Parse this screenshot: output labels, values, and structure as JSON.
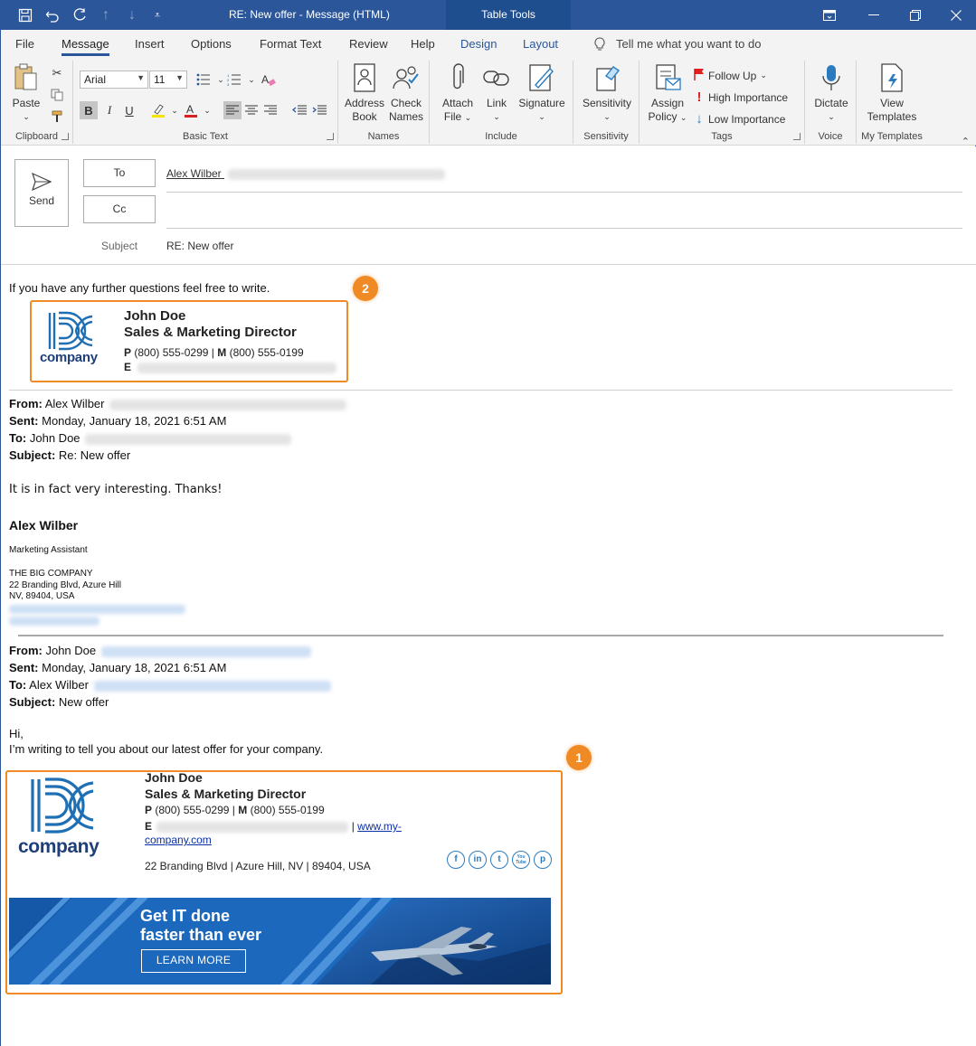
{
  "window": {
    "title": "RE: New offer  -  Message (HTML)",
    "context_tab": "Table Tools",
    "accent": "#2b579a"
  },
  "tabs": [
    "File",
    "Message",
    "Insert",
    "Options",
    "Format Text",
    "Review",
    "Help",
    "Design",
    "Layout"
  ],
  "tell_me": "Tell me what you want to do",
  "ribbon": {
    "clipboard": {
      "paste": "Paste",
      "label": "Clipboard"
    },
    "basic_text": {
      "font": "Arial",
      "size": "11",
      "label": "Basic Text"
    },
    "names": {
      "address_book_1": "Address",
      "address_book_2": "Book",
      "check_names_1": "Check",
      "check_names_2": "Names",
      "label": "Names"
    },
    "include": {
      "attach_1": "Attach",
      "attach_2": "File",
      "link": "Link",
      "signature": "Signature",
      "label": "Include"
    },
    "sensitivity": {
      "button": "Sensitivity",
      "label": "Sensitivity"
    },
    "tags": {
      "assign_1": "Assign",
      "assign_2": "Policy",
      "follow_up": "Follow Up",
      "high": "High Importance",
      "low": "Low Importance",
      "label": "Tags"
    },
    "voice": {
      "dictate": "Dictate",
      "label": "Voice"
    },
    "templates": {
      "view_1": "View",
      "view_2": "Templates",
      "label": "My Templates"
    }
  },
  "compose": {
    "send": "Send",
    "to_button": "To",
    "cc_button": "Cc",
    "to_value": "Alex Wilber",
    "subject_label": "Subject",
    "subject_value": "RE: New offer"
  },
  "message": {
    "intro": "If you have any further questions feel free to write.",
    "sig_top": {
      "badge": "2",
      "name": "John Doe",
      "title": "Sales & Marketing Director",
      "phone_p": "P",
      "phone_p_val": "(800) 555-0299",
      "sep": "|",
      "phone_m": "M",
      "phone_m_val": "(800) 555-0199",
      "email_label": "E",
      "logo_text": "company"
    },
    "reply1": {
      "from_label": "From:",
      "from_value": "Alex Wilber",
      "sent_label": "Sent:",
      "sent_value": "Monday, January 18, 2021 6:51 AM",
      "to_label": "To:",
      "to_value": "John Doe",
      "subject_label": "Subject:",
      "subject_value": "Re: New offer",
      "body": "It is in fact very interesting. Thanks!",
      "sig_name": "Alex Wilber",
      "sig_title": "Marketing Assistant",
      "sig_company": "THE BIG COMPANY",
      "sig_addr1": "22 Branding Blvd, Azure Hill",
      "sig_addr2": "NV, 89404, USA"
    },
    "reply2": {
      "from_label": "From:",
      "from_value": "John Doe",
      "sent_label": "Sent:",
      "sent_value": "Monday, January 18, 2021 6:51 AM",
      "to_label": "To:",
      "to_value": "Alex Wilber",
      "subject_label": "Subject:",
      "subject_value": "New offer",
      "greeting": "Hi,",
      "body": "I’m writing to tell you about our latest offer for your company."
    },
    "sig_bottom": {
      "badge": "1",
      "name": "John Doe",
      "title": "Sales & Marketing Director",
      "phone_p": "P",
      "phone_p_val": "(800) 555-0299",
      "sep": "|",
      "phone_m": "M",
      "phone_m_val": "(800) 555-0199",
      "email_label": "E",
      "website_1": "www.my-",
      "website_2": "company.com",
      "address": "22 Branding Blvd | Azure Hill, NV | 89404, USA",
      "logo_text": "company",
      "social": [
        "f",
        "in",
        "t",
        "You Tube",
        "p"
      ],
      "banner_line1": "Get IT done",
      "banner_line2": "faster than ever",
      "banner_button": "LEARN MORE"
    },
    "highlight_color": "#f08a24"
  }
}
